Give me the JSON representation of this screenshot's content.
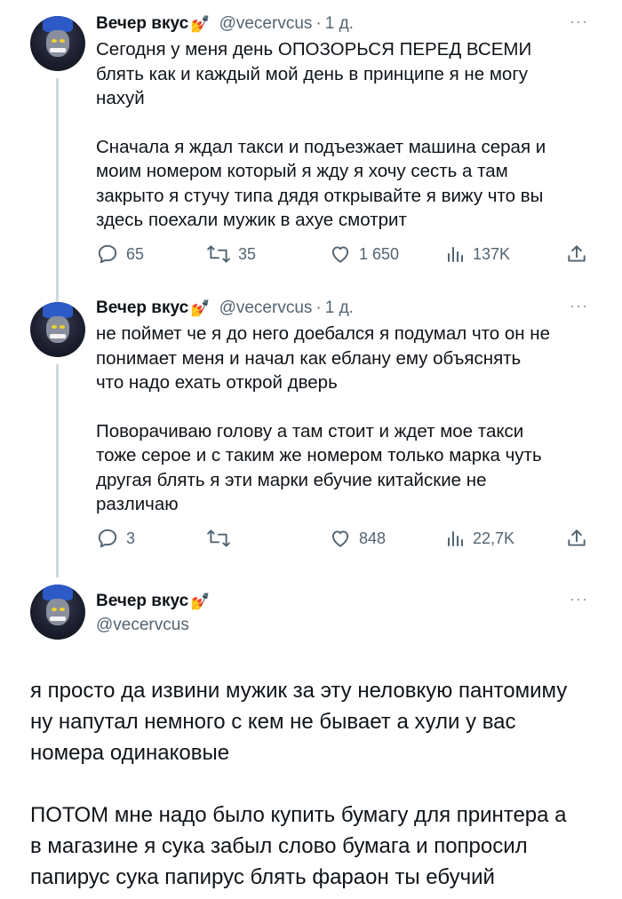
{
  "tweets": [
    {
      "author": {
        "name": "Вечер вкус",
        "badge": "💅",
        "handle": "@vecervcus",
        "time": "1 д."
      },
      "more": "···",
      "paragraphs": [
        [
          "Сегодня у меня день ОПОЗОРЬСЯ ПЕРЕД ВСЕМИ",
          "блять как и каждый мой день в принципе я не могу",
          "нахуй"
        ],
        [
          "Сначала я ждал такси и подъезжает машина серая и",
          "моим номером который я жду я хочу сесть а там",
          "закрыто я стучу типа дядя открывайте я вижу что вы",
          "здесь поехали мужик в ахуе смотрит"
        ]
      ],
      "stats": {
        "replies": "65",
        "reposts": "35",
        "likes": "1 650",
        "views": "137K"
      }
    },
    {
      "author": {
        "name": "Вечер вкус",
        "badge": "💅",
        "handle": "@vecervcus",
        "time": "1 д."
      },
      "more": "···",
      "paragraphs": [
        [
          "не поймет че я до него доебался я подумал что он не",
          "понимает меня и начал как еблану ему объяснять",
          "что надо ехать открой дверь"
        ],
        [
          "Поворачиваю голову а там стоит и ждет мое такси",
          "тоже серое и с таким же номером только марка чуть",
          "другая блять я эти марки ебучие китайские не",
          "различаю"
        ]
      ],
      "stats": {
        "replies": "3",
        "reposts": "",
        "likes": "848",
        "views": "22,7K"
      }
    },
    {
      "author": {
        "name": "Вечер вкус",
        "badge": "💅",
        "handle": "@vecervcus"
      },
      "more": "···",
      "paragraphs": [
        [
          "я просто да извини мужик за эту неловкую пантомиму",
          "ну напутал немного с кем не бывает а хули у вас",
          "номера одинаковые"
        ],
        [
          "ПОТОМ мне надо было купить бумагу для принтера а",
          "в магазине я сука забыл слово бумага и попросил",
          "папирус сука папирус блять фараон ты ебучий"
        ]
      ]
    }
  ],
  "icons": {
    "reply": "reply-icon",
    "repost": "repost-icon",
    "like": "heart-icon",
    "views": "views-bar-chart-icon",
    "share": "share-icon",
    "more": "more-dots-icon"
  },
  "colors": {
    "text": "#0f1419",
    "secondary": "#536471",
    "thread_line": "#cfd9de",
    "badge": "#d9a71f"
  }
}
